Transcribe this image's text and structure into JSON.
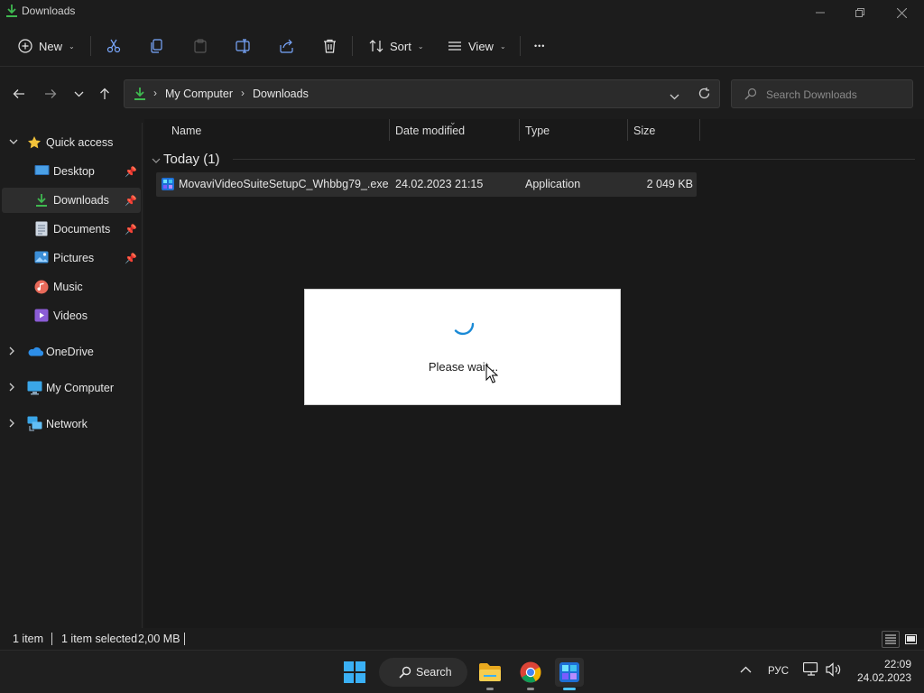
{
  "window": {
    "title": "Downloads"
  },
  "toolbar": {
    "new_label": "New",
    "sort_label": "Sort",
    "view_label": "View",
    "more_label": "•••"
  },
  "address": {
    "crumbs": [
      "My Computer",
      "Downloads"
    ],
    "search_placeholder": "Search Downloads"
  },
  "sidebar": {
    "items": [
      {
        "label": "Quick access",
        "icon": "star-icon"
      },
      {
        "label": "Desktop",
        "icon": "desktop-icon"
      },
      {
        "label": "Downloads",
        "icon": "download-icon",
        "selected": true
      },
      {
        "label": "Documents",
        "icon": "document-icon"
      },
      {
        "label": "Pictures",
        "icon": "pictures-icon"
      },
      {
        "label": "Music",
        "icon": "music-icon"
      },
      {
        "label": "Videos",
        "icon": "videos-icon"
      },
      {
        "label": "OneDrive",
        "icon": "cloud-icon"
      },
      {
        "label": "My Computer",
        "icon": "computer-icon"
      },
      {
        "label": "Network",
        "icon": "network-icon"
      }
    ]
  },
  "columns": {
    "name": "Name",
    "date": "Date modified",
    "type": "Type",
    "size": "Size"
  },
  "group": {
    "label": "Today (1)"
  },
  "files": [
    {
      "name": "MovaviVideoSuiteSetupC_Whbbg79_.exe",
      "date": "24.02.2023 21:15",
      "type": "Application",
      "size": "2 049 KB"
    }
  ],
  "dialog": {
    "message": "Please wait..."
  },
  "status": {
    "count": "1 item",
    "selected": "1 item selected",
    "size": "2,00 MB"
  },
  "taskbar": {
    "search_label": "Search",
    "language": "РУС",
    "time": "22:09",
    "date": "24.02.2023"
  },
  "colors": {
    "accent": "#4cc2ff",
    "background": "#1c1c1c",
    "download_green": "#3fb950",
    "folder_yellow": "#f2c23a"
  }
}
